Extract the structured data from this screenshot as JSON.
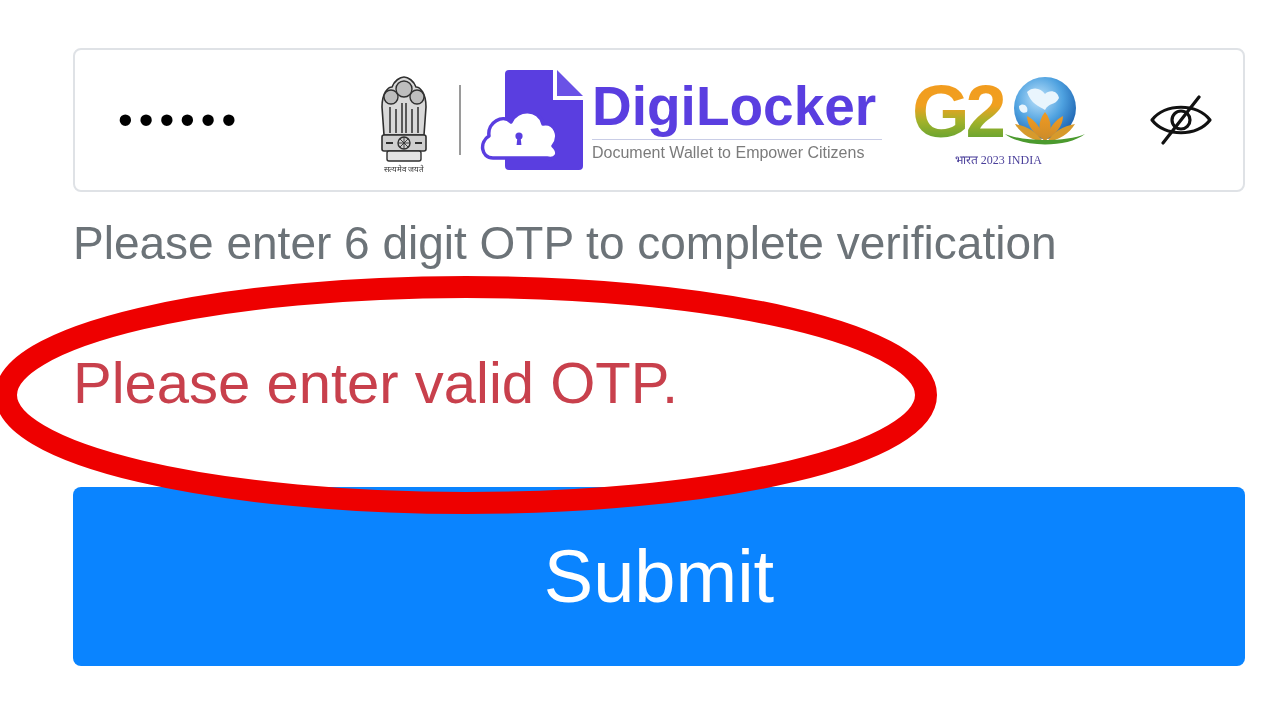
{
  "otp_field": {
    "value": "••••••",
    "masked": true
  },
  "logos": {
    "emblem_motto": "सत्यमेव जयते",
    "brand_name": "DigiLocker",
    "brand_tagline": "Document Wallet to Empower Citizens",
    "g20_mark": "G2",
    "g20_caption": "भारत 2023 INDIA"
  },
  "hint": "Please enter 6 digit OTP to complete verification",
  "error": "Please enter valid OTP.",
  "submit_button": {
    "label": "Submit"
  }
}
